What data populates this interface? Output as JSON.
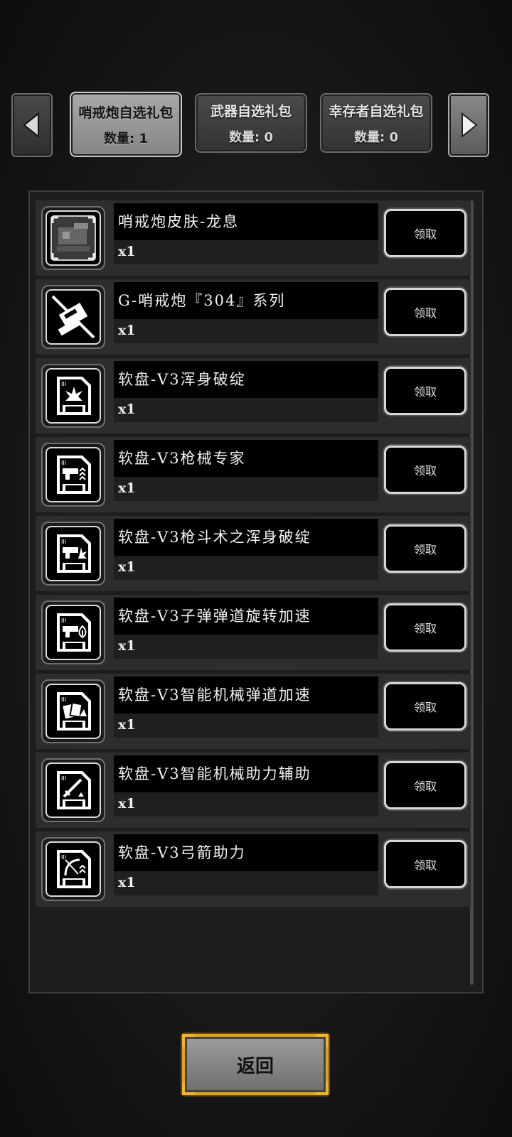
{
  "nav": {
    "prev_icon": "left-arrow-icon",
    "next_icon": "right-arrow-icon"
  },
  "tabs": [
    {
      "title": "哨戒炮自选礼包",
      "count": "数量: 1",
      "active": true
    },
    {
      "title": "武器自选礼包",
      "count": "数量: 0",
      "active": false
    },
    {
      "title": "幸存者自选礼包",
      "count": "数量: 0",
      "active": false
    }
  ],
  "items": [
    {
      "name": "哨戒炮皮肤-龙息",
      "qty": "x1",
      "claim_label": "领取",
      "icon": "turret-skin-icon"
    },
    {
      "name": "G-哨戒炮『304』系列",
      "qty": "x1",
      "claim_label": "领取",
      "icon": "turret-series-icon"
    },
    {
      "name": "软盘-V3浑身破绽",
      "qty": "x1",
      "claim_label": "领取",
      "icon": "floppy-disk-icon"
    },
    {
      "name": "软盘-V3枪械专家",
      "qty": "x1",
      "claim_label": "领取",
      "icon": "floppy-disk-icon"
    },
    {
      "name": "软盘-V3枪斗术之浑身破绽",
      "qty": "x1",
      "claim_label": "领取",
      "icon": "floppy-disk-icon"
    },
    {
      "name": "软盘-V3子弹弹道旋转加速",
      "qty": "x1",
      "claim_label": "领取",
      "icon": "floppy-disk-icon"
    },
    {
      "name": "软盘-V3智能机械弹道加速",
      "qty": "x1",
      "claim_label": "领取",
      "icon": "floppy-disk-icon"
    },
    {
      "name": "软盘-V3智能机械助力辅助",
      "qty": "x1",
      "claim_label": "领取",
      "icon": "floppy-disk-icon"
    },
    {
      "name": "软盘-V3弓箭助力",
      "qty": "x1",
      "claim_label": "领取",
      "icon": "floppy-disk-icon"
    }
  ],
  "back_button": {
    "label": "返回"
  },
  "colors": {
    "accent_gold": "#e0a21a",
    "panel_bg": "#1e1e1e"
  }
}
